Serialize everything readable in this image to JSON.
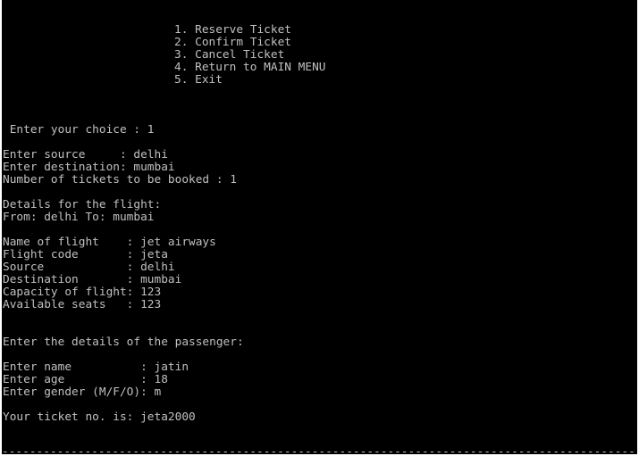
{
  "console": {
    "menu": [
      "1. Reserve Ticket",
      "2. Confirm Ticket",
      "3. Cancel Ticket",
      "4. Return to MAIN MENU",
      "5. Exit"
    ],
    "choice_line": " Enter your choice : 1",
    "source_line": "Enter source     : delhi",
    "destination_line": "Enter destination: mumbai",
    "tickets_line": "Number of tickets to be booked : 1",
    "details_heading": "Details for the flight:",
    "route_line": "From: delhi To: mumbai",
    "flight_details": [
      "Name of flight    : jet airways",
      "Flight code       : jeta",
      "Source            : delhi",
      "Destination       : mumbai",
      "Capacity of flight: 123",
      "Available seats   : 123"
    ],
    "passenger_heading": "Enter the details of the passenger:",
    "passenger_inputs": [
      "Enter name          : jatin",
      "Enter age           : 18",
      "Enter gender (M/F/O): m"
    ],
    "ticket_line": "Your ticket no. is: jeta2000",
    "separator_line": "----------------------------------------------------------------------------------------------"
  },
  "colors": {
    "background": "#000000",
    "text": "#c0c0c0"
  }
}
